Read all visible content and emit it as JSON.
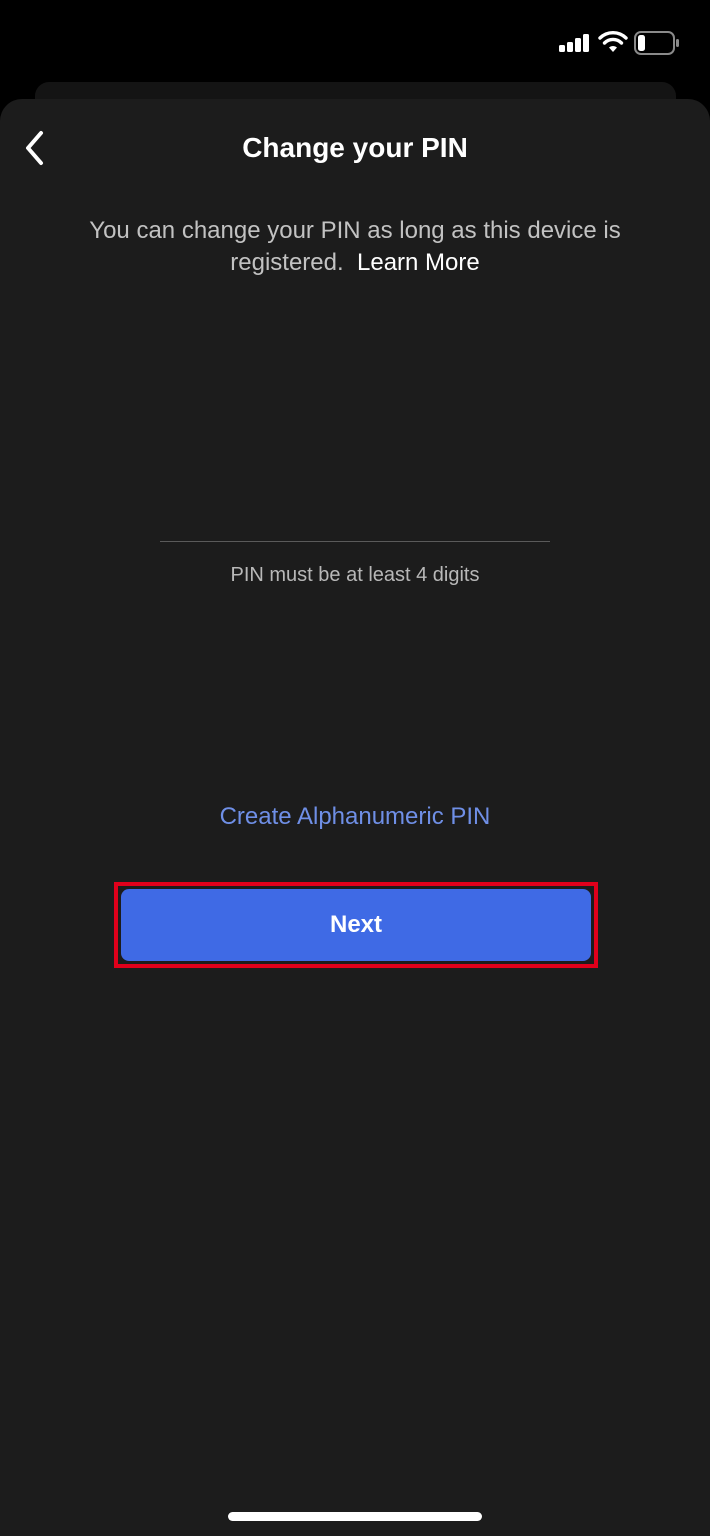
{
  "header": {
    "title": "Change your PIN",
    "back_icon": "chevron-left-icon"
  },
  "description": {
    "text": "You can change your PIN as long as this device is registered.",
    "link": "Learn More"
  },
  "pin": {
    "value": "",
    "hint": "PIN must be at least 4 digits"
  },
  "alphanumeric_link": "Create Alphanumeric PIN",
  "next_button": "Next",
  "colors": {
    "background": "#1c1c1c",
    "accent": "#3f6ae5",
    "link": "#6f8fe6",
    "highlight": "#e0001b"
  },
  "status_icons": [
    "signal-icon",
    "wifi-icon",
    "battery-icon"
  ]
}
